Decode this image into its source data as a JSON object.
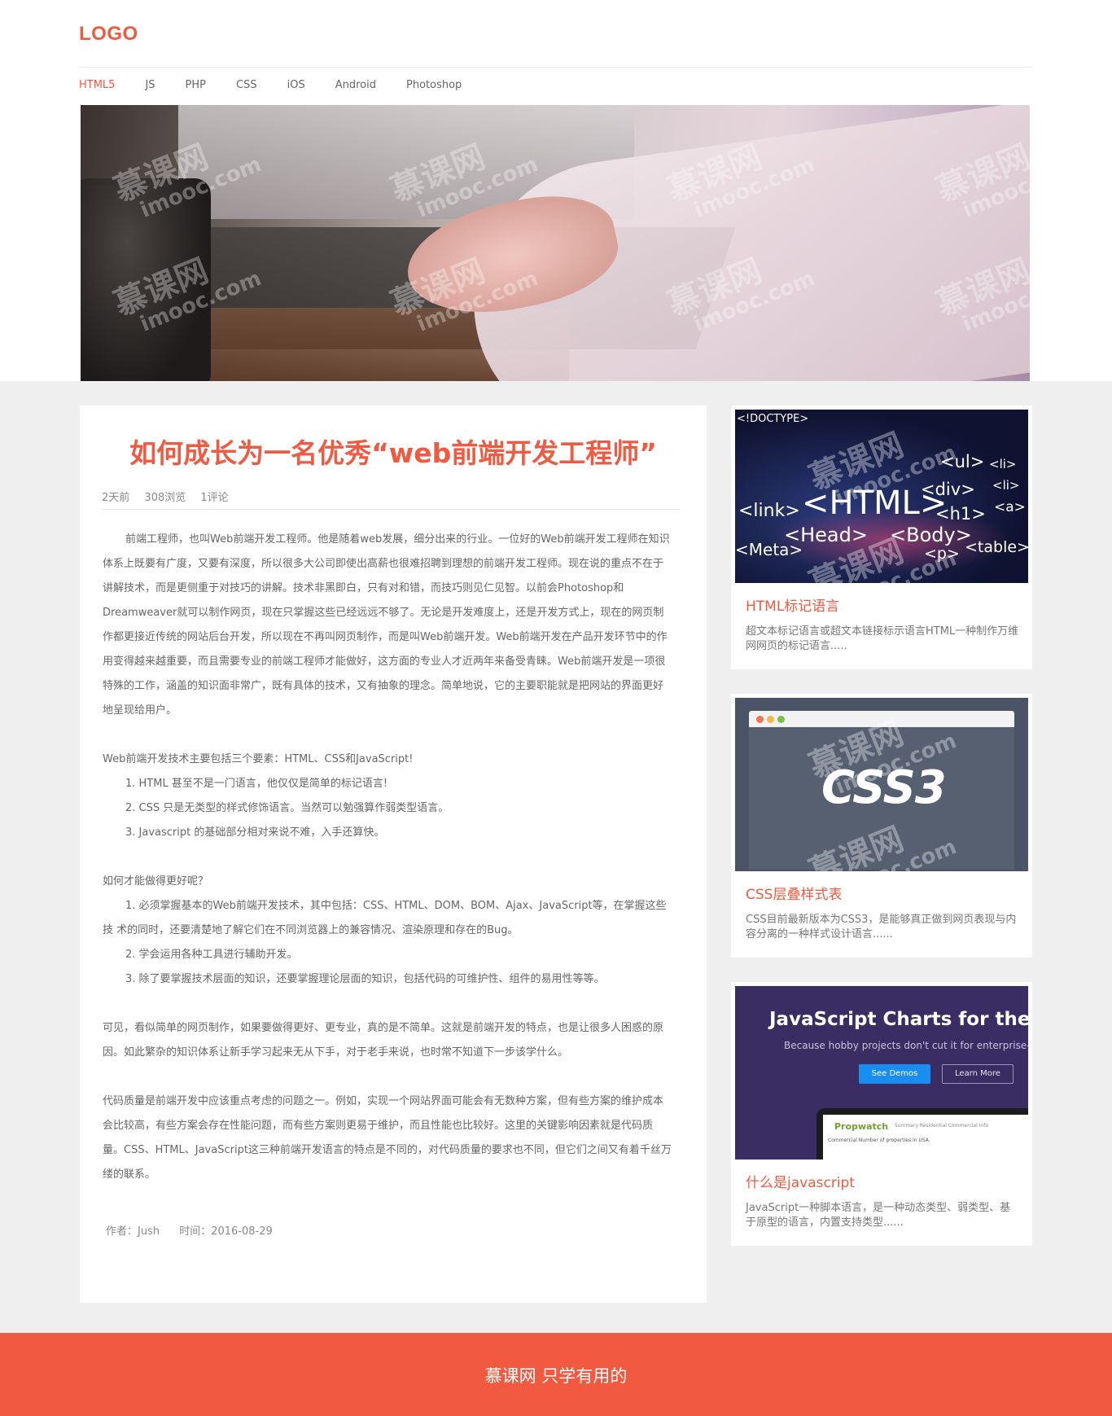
{
  "header": {
    "logo": "LOGO",
    "nav": [
      "HTML5",
      "JS",
      "PHP",
      "CSS",
      "iOS",
      "Android",
      "Photoshop"
    ],
    "active_nav": "HTML5"
  },
  "watermark": {
    "cn": "慕课网",
    "en": "imooc.com"
  },
  "article": {
    "title": "如何成长为一名优秀“web前端开发工程师”",
    "meta": {
      "time": "2天前",
      "views": "308浏览",
      "comments": "1评论"
    },
    "paragraphs": [
      "前端工程师，也叫Web前端开发工程师。他是随着web发展，细分出来的行业。一位好的Web前端开发工程师在知识体系上既要有广度，又要有深度，所以很多大公司即使出高薪也很难招聘到理想的前端开发工程师。现在说的重点不在于讲解技术，而是更侧重于对技巧的讲解。技术非黑即白，只有对和错，而技巧则见仁见智。以前会Photoshop和Dreamweaver就可以制作网页，现在只掌握这些已经远远不够了。无论是开发难度上，还是开发方式上，现在的网页制作都更接近传统的网站后台开发，所以现在不再叫网页制作，而是叫Web前端开发。Web前端开发在产品开发环节中的作用变得越来越重要，而且需要专业的前端工程师才能做好，这方面的专业人才近两年来备受青睐。Web前端开发是一项很特殊的工作，涵盖的知识面非常广，既有具体的技术，又有抽象的理念。简单地说，它的主要职能就是把网站的界面更好地呈现给用户。"
    ],
    "section2": {
      "intro": "Web前端开发技术主要包括三个要素：HTML、CSS和JavaScript!",
      "items": [
        "1. HTML 甚至不是一门语言，他仅仅是简单的标记语言!",
        "2. CSS 只是无类型的样式修饰语言。当然可以勉强算作弱类型语言。",
        "3. Javascript 的基础部分相对来说不难，入手还算快。"
      ]
    },
    "section3": {
      "intro": "如何才能做得更好呢？",
      "items": [
        "1. 必须掌握基本的Web前端开发技术，其中包括：CSS、HTML、DOM、BOM、Ajax、JavaScript等，在掌握这些技    术的同时，还要清楚地了解它们在不同浏览器上的兼容情况、渲染原理和存在的Bug。",
        "2. 学会运用各种工具进行辅助开发。",
        "3. 除了要掌握技术层面的知识，还要掌握理论层面的知识，包括代码的可维护性、组件的易用性等等。"
      ]
    },
    "paragraph4": "可见，看似简单的网页制作，如果要做得更好、更专业，真的是不简单。这就是前端开发的特点，也是让很多人困惑的原因。如此繁杂的知识体系让新手学习起来无从下手，对于老手来说，也时常不知道下一步该学什么。",
    "paragraph5": "代码质量是前端开发中应该重点考虑的问题之一。例如，实现一个网站界面可能会有无数种方案，但有些方案的维护成本会比较高，有些方案会存在性能问题，而有些方案则更易于维护，而且性能也比较好。这里的关键影响因素就是代码质量。CSS、HTML、JavaScript这三种前端开发语言的特点是不同的，对代码质量的要求也不同，但它们之间又有着千丝万缕的联系。",
    "author": "作者：Jush",
    "date": "时间：2016-08-29"
  },
  "sidebar": [
    {
      "title": "HTML标记语言",
      "desc": "超文本标记语言或超文本链接标示语言HTML一种制作万维网网页的标记语言.....",
      "thumb_tags": [
        "<!DOCTYPE>",
        "<ul>",
        "<li>",
        "<li>",
        "<div>",
        "<HTML>",
        "<link>",
        "<h1>",
        "<a>",
        "<Head>",
        "<Body>",
        "<Meta>",
        "<table>",
        "<p>"
      ]
    },
    {
      "title": "CSS层叠样式表",
      "desc": "CSS目前最新版本为CSS3，是能够真正做到网页表现与内容分离的一种样式设计语言......",
      "thumb_text": "CSS3"
    },
    {
      "title": "什么是javascript",
      "desc": "JavaScript一种脚本语言，是一种动态类型、弱类型、基于原型的语言，内置支持类型......",
      "thumb": {
        "heading": "JavaScript Charts for the Gro",
        "sub": "Because hobby projects don't cut it for enterprise-grad",
        "btn1": "See Demos",
        "btn2": "Learn More",
        "brand": "Propwatch",
        "brand_sub": "Summary   Residential   Commercial   Info",
        "row": "Commercial        Number of properties in USA"
      }
    }
  ],
  "footer": {
    "text": "慕课网 只学有用的"
  },
  "colors": {
    "accent": "#f05a40",
    "footer_bg": "#f15a40",
    "page_bg": "#efefef"
  }
}
